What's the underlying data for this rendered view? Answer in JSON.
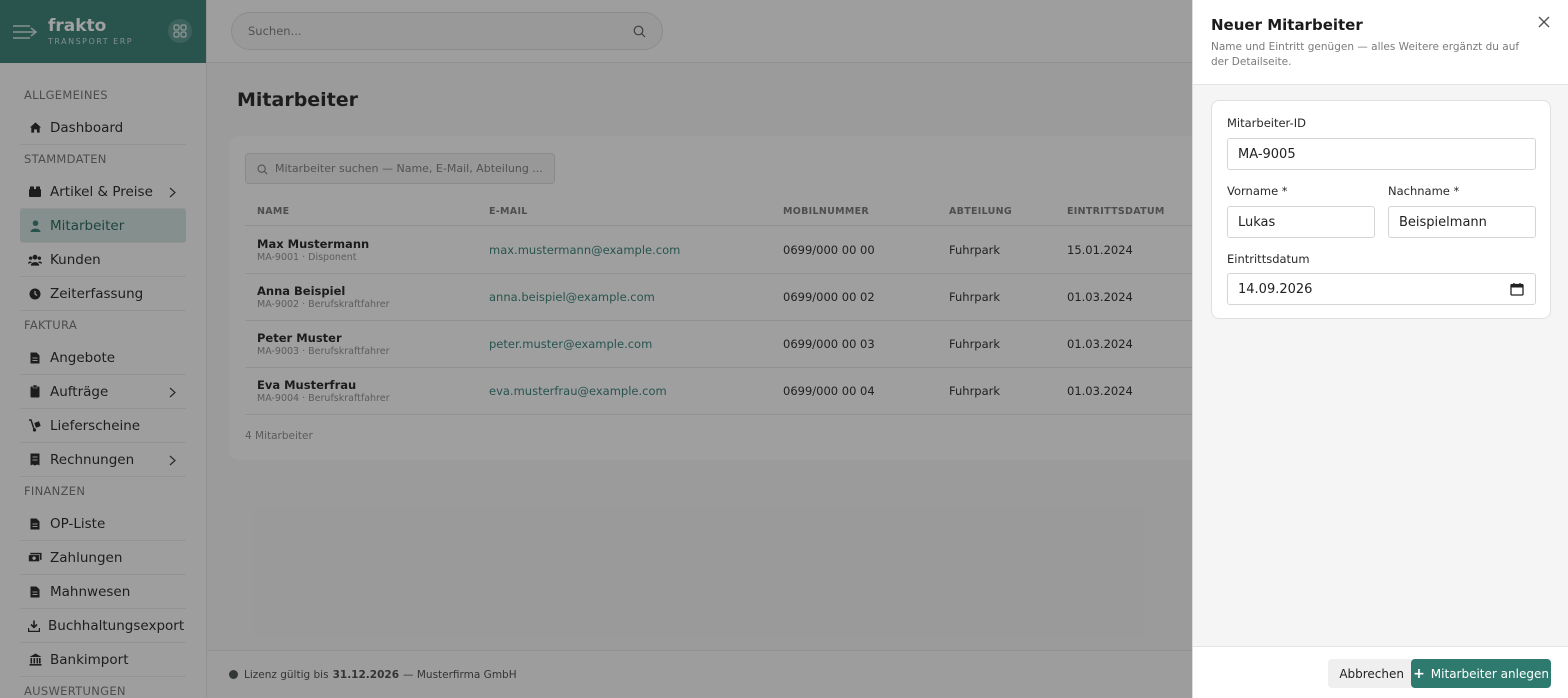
{
  "brand": {
    "name": "frakto",
    "sub": "TRANSPORT ERP"
  },
  "topbar": {
    "search_placeholder": "Suchen..."
  },
  "sidebar": {
    "sections": [
      {
        "title": "ALLGEMEINES",
        "items": [
          {
            "label": "Dashboard",
            "icon": "home-icon"
          }
        ]
      },
      {
        "title": "STAMMDATEN",
        "items": [
          {
            "label": "Artikel & Preise",
            "icon": "boxes-icon",
            "chevron": true
          },
          {
            "label": "Mitarbeiter",
            "icon": "user-icon",
            "active": true
          },
          {
            "label": "Kunden",
            "icon": "users-icon"
          },
          {
            "label": "Zeiterfassung",
            "icon": "clock-icon"
          }
        ]
      },
      {
        "title": "FAKTURA",
        "items": [
          {
            "label": "Angebote",
            "icon": "document-icon"
          },
          {
            "label": "Aufträge",
            "icon": "clipboard-icon",
            "chevron": true
          },
          {
            "label": "Lieferscheine",
            "icon": "dolly-icon"
          },
          {
            "label": "Rechnungen",
            "icon": "invoice-icon",
            "chevron": true
          }
        ]
      },
      {
        "title": "FINANZEN",
        "items": [
          {
            "label": "OP-Liste",
            "icon": "document-icon"
          },
          {
            "label": "Zahlungen",
            "icon": "money-icon"
          },
          {
            "label": "Mahnwesen",
            "icon": "document-icon"
          },
          {
            "label": "Buchhaltungsexport",
            "icon": "download-icon"
          },
          {
            "label": "Bankimport",
            "icon": "bank-icon"
          }
        ]
      },
      {
        "title": "AUSWERTUNGEN",
        "items": []
      }
    ]
  },
  "main": {
    "title": "Mitarbeiter",
    "table_search_placeholder": "Mitarbeiter suchen — Name, E-Mail, Abteilung ...",
    "columns": [
      "NAME",
      "E-MAIL",
      "MOBILNUMMER",
      "ABTEILUNG",
      "EINTRITTSDATUM"
    ],
    "rows": [
      {
        "name": "Max Mustermann",
        "sub": "MA-9001 · Disponent",
        "email": "max.mustermann@example.com",
        "mobile": "0699/000 00 00",
        "dept": "Fuhrpark",
        "date": "15.01.2024"
      },
      {
        "name": "Anna Beispiel",
        "sub": "MA-9002 · Berufskraftfahrer",
        "email": "anna.beispiel@example.com",
        "mobile": "0699/000 00 02",
        "dept": "Fuhrpark",
        "date": "01.03.2024"
      },
      {
        "name": "Peter Muster",
        "sub": "MA-9003 · Berufskraftfahrer",
        "email": "peter.muster@example.com",
        "mobile": "0699/000 00 03",
        "dept": "Fuhrpark",
        "date": "01.03.2024"
      },
      {
        "name": "Eva Musterfrau",
        "sub": "MA-9004 · Berufskraftfahrer",
        "email": "eva.musterfrau@example.com",
        "mobile": "0699/000 00 04",
        "dept": "Fuhrpark",
        "date": "01.03.2024"
      }
    ],
    "count_label": "4 Mitarbeiter"
  },
  "footer": {
    "prefix": "Lizenz gültig bis",
    "date": "31.12.2026",
    "suffix": "— Musterfirma GmbH"
  },
  "drawer": {
    "title": "Neuer Mitarbeiter",
    "subtitle": "Name und Eintritt genügen — alles Weitere ergänzt du auf der Detailseite.",
    "fields": {
      "id_label": "Mitarbeiter-ID",
      "id_value": "MA-9005",
      "first_label": "Vorname *",
      "first_value": "Lukas",
      "last_label": "Nachname *",
      "last_value": "Beispielmann",
      "date_label": "Eintrittsdatum",
      "date_value": "14.09.2026"
    },
    "cancel_label": "Abbrechen",
    "submit_label": "Mitarbeiter anlegen"
  },
  "colors": {
    "primary": "#2f7a6f",
    "active_bg": "#cfe1dd"
  }
}
